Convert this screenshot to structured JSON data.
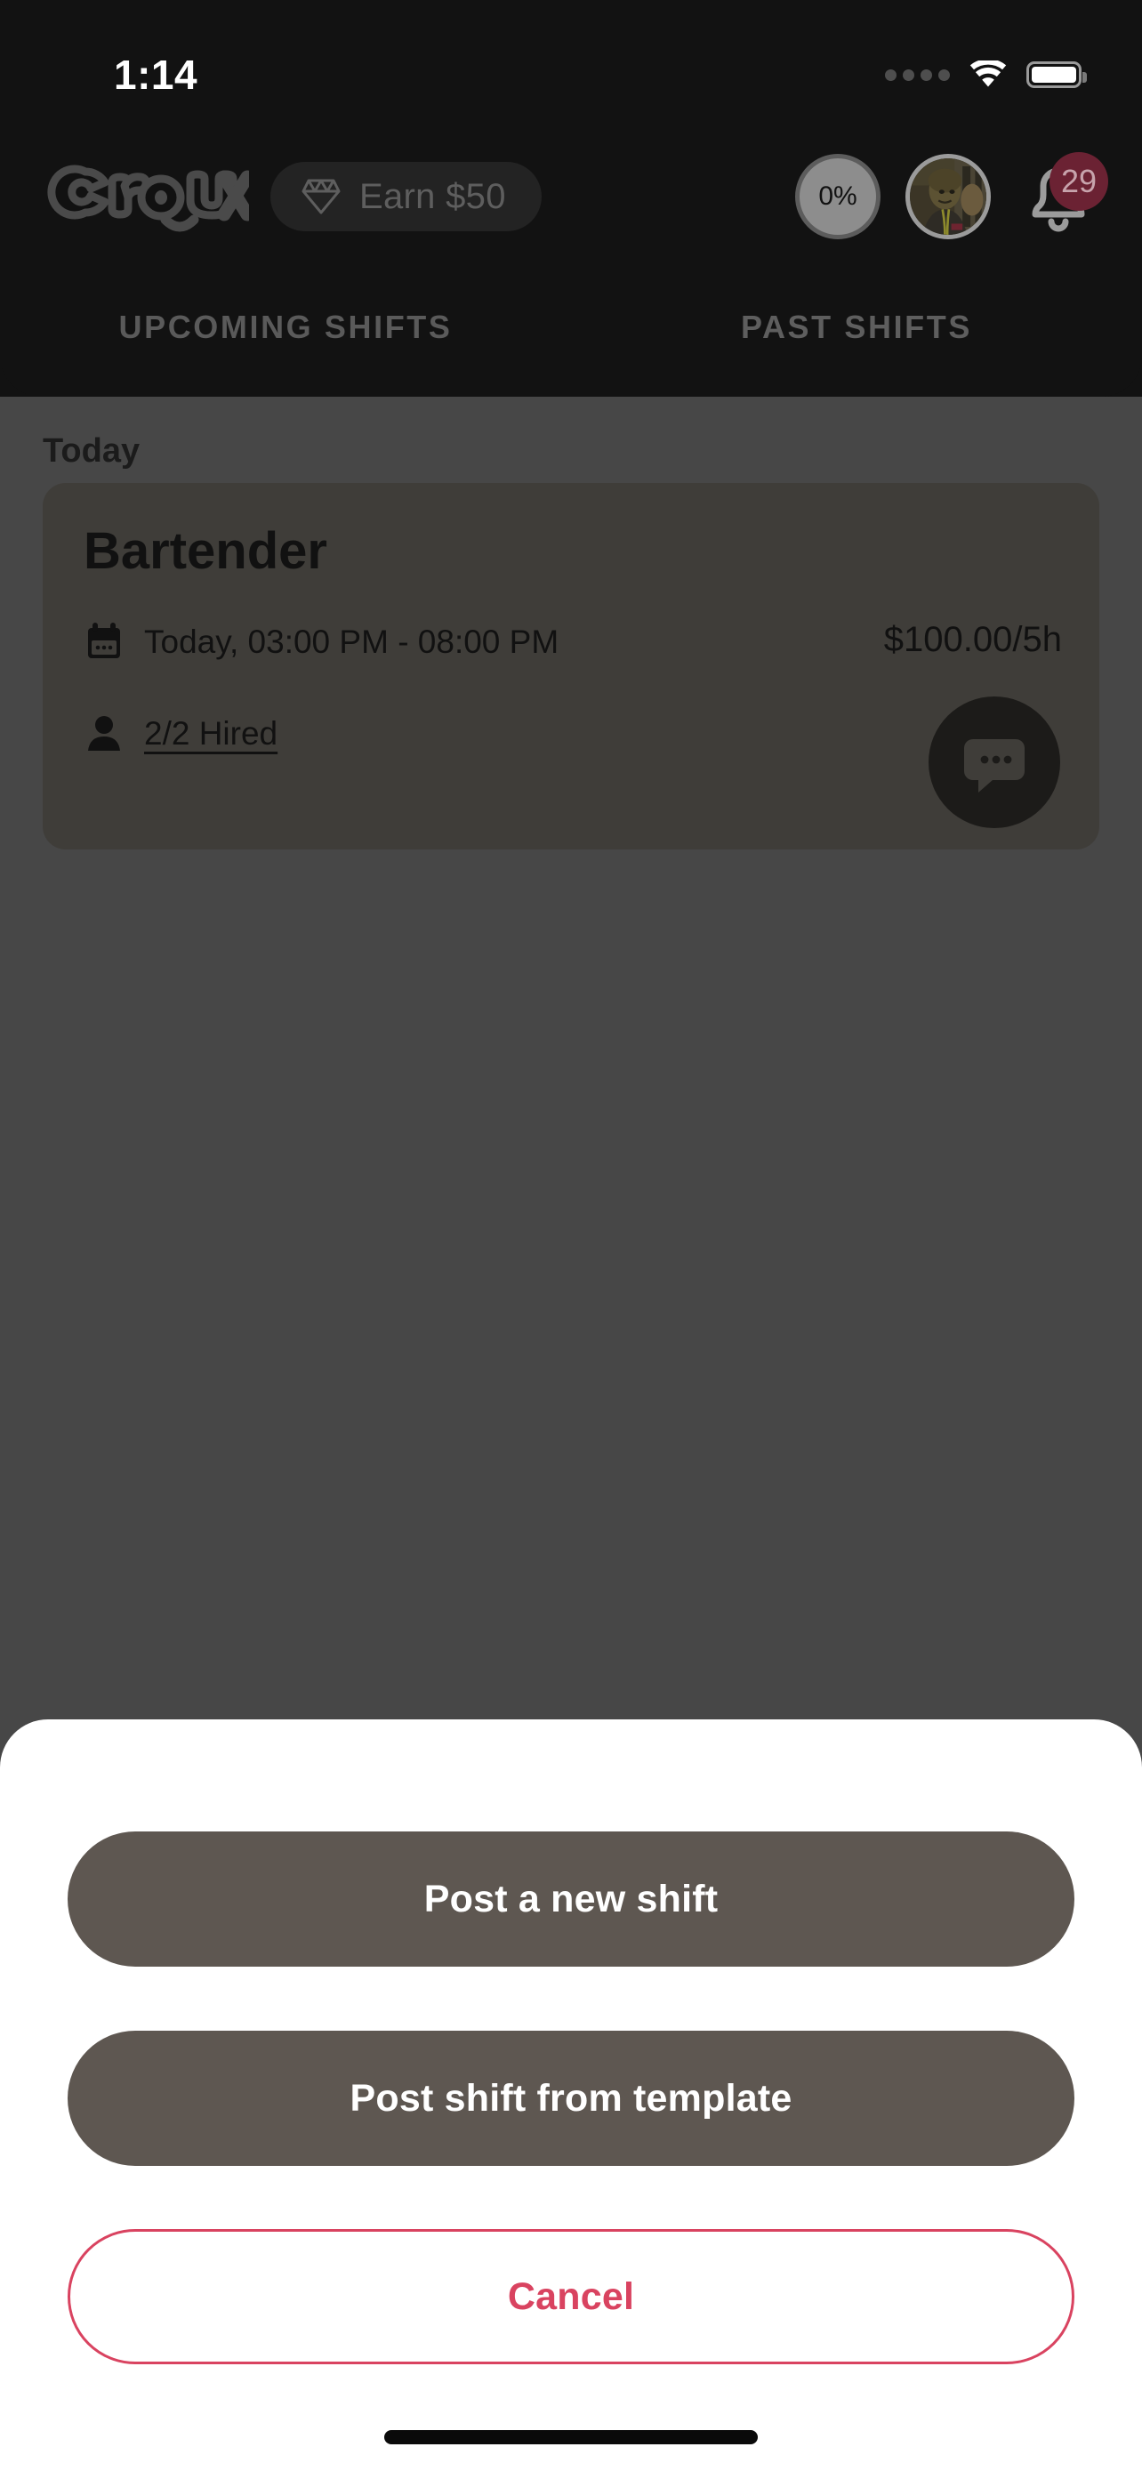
{
  "status_bar": {
    "time": "1:14",
    "cellular_icon": "signal-dots-icon",
    "wifi_icon": "wifi-icon",
    "battery_icon": "battery-full-icon"
  },
  "header": {
    "brand_name": "Croux",
    "brand_logo_icon": "croux-logo-icon",
    "earn_pill": {
      "icon": "gem-icon",
      "label": "Earn $50"
    },
    "progress": {
      "value": "0%",
      "icon": "progress-ring-icon"
    },
    "avatar_icon": "user-avatar-icon",
    "notifications": {
      "icon": "bell-icon",
      "badge_count": "29"
    }
  },
  "tabs": [
    {
      "id": "upcoming",
      "label": "UPCOMING SHIFTS",
      "active": false
    },
    {
      "id": "past",
      "label": "PAST SHIFTS",
      "active": true
    }
  ],
  "content": {
    "section_title": "Today",
    "shift": {
      "title": "Bartender",
      "calendar_icon": "calendar-icon",
      "time_text": "Today, 03:00 PM - 08:00 PM",
      "people_icon": "person-icon",
      "hired_text": "2/2 Hired",
      "price_text": "$100.00/5h",
      "chat_icon": "chat-bubble-icon"
    }
  },
  "action_sheet": {
    "primary_label": "Post a new shift",
    "secondary_label": "Post shift from template",
    "cancel_label": "Cancel"
  },
  "colors": {
    "header_background": "#121212",
    "dim_overlay": "#474747",
    "card_background": "#3f3d39",
    "sheet_background": "#ffffff",
    "sheet_button": "#5e5751",
    "cancel_accent": "#d94360",
    "badge_background": "#6b2233"
  }
}
